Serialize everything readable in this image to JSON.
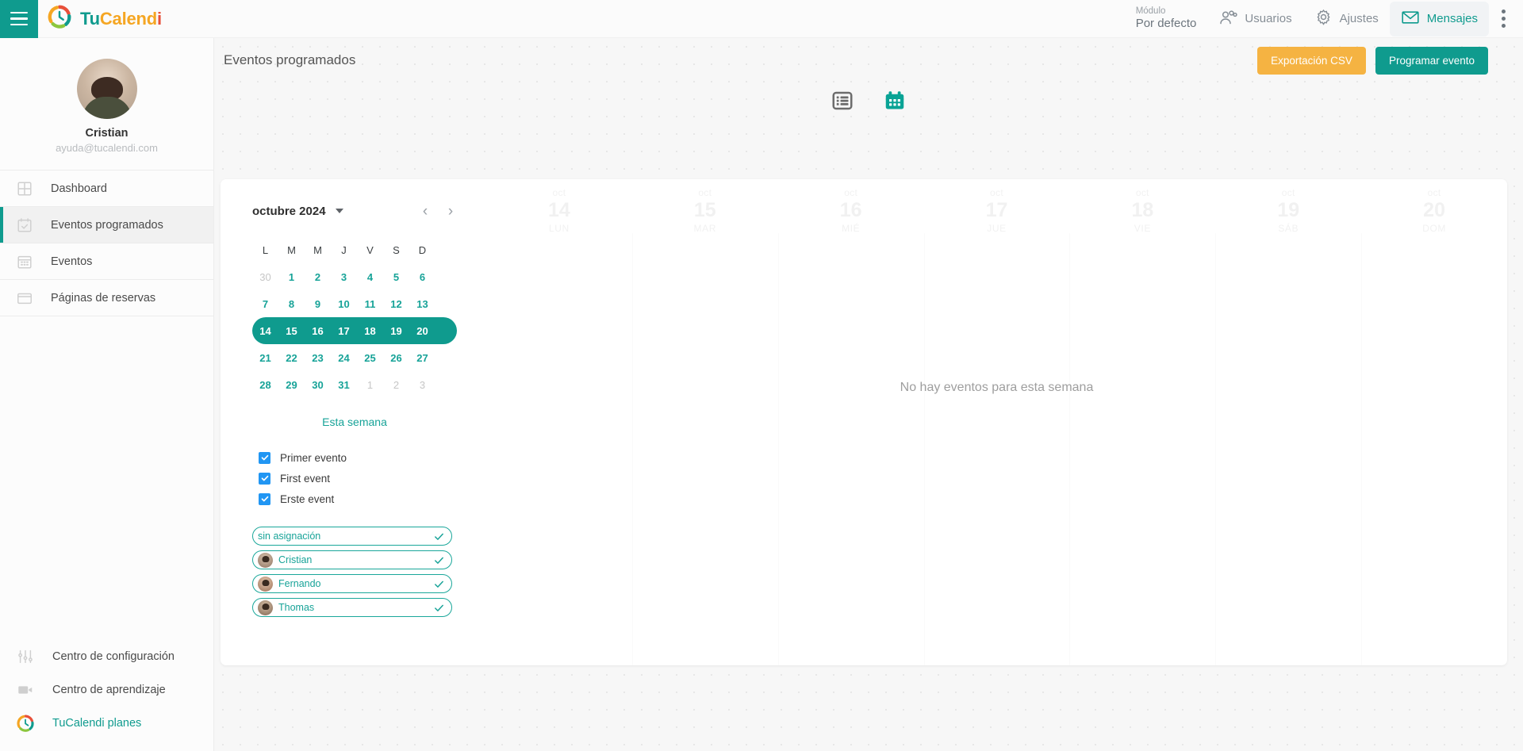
{
  "topbar": {
    "menu_icon": "hamburger-icon",
    "brand": {
      "part1": "Tu",
      "part2": "Calend",
      "part3": "i"
    },
    "module": {
      "label": "Módulo",
      "value": "Por defecto"
    },
    "nav": [
      {
        "label": "Usuarios",
        "icon": "users-icon",
        "active": false
      },
      {
        "label": "Ajustes",
        "icon": "gear-icon",
        "active": false
      },
      {
        "label": "Mensajes",
        "icon": "envelope-icon",
        "active": true
      }
    ],
    "overflow_icon": "more-vertical-icon",
    "accent": "#0f9b8e"
  },
  "sidebar": {
    "profile": {
      "name": "Cristian",
      "email": "ayuda@tucalendi.com",
      "avatar": "user-avatar"
    },
    "items": [
      {
        "label": "Dashboard",
        "icon": "dashboard-icon",
        "active": false
      },
      {
        "label": "Eventos programados",
        "icon": "calendar-check-icon",
        "active": true
      },
      {
        "label": "Eventos",
        "icon": "calendar-grid-icon",
        "active": false
      },
      {
        "label": "Páginas de reservas",
        "icon": "window-icon",
        "active": false
      }
    ],
    "bottom_items": [
      {
        "label": "Centro de configuración",
        "icon": "sliders-icon"
      },
      {
        "label": "Centro de aprendizaje",
        "icon": "video-camera-icon"
      },
      {
        "label": "TuCalendi planes",
        "icon": "tucalendi-logo-icon"
      }
    ]
  },
  "header": {
    "title": "Eventos programados",
    "export_button": "Exportación CSV",
    "schedule_button": "Programar evento",
    "export_color": "#f5b342",
    "schedule_color": "#0f9b8e"
  },
  "view_toggle": [
    {
      "name": "list-view",
      "icon": "list-icon",
      "active": false
    },
    {
      "name": "calendar-view",
      "icon": "calendar-icon",
      "active": true
    }
  ],
  "calendar": {
    "month_label": "octubre 2024",
    "caret_icon": "chevron-down-icon",
    "prev_icon": "chevron-left-icon",
    "next_icon": "chevron-right-icon",
    "dow": [
      "L",
      "M",
      "M",
      "J",
      "V",
      "S",
      "D"
    ],
    "weeks": [
      {
        "selected": false,
        "days": [
          {
            "n": "30",
            "muted": true
          },
          {
            "n": "1",
            "muted": false
          },
          {
            "n": "2",
            "muted": false
          },
          {
            "n": "3",
            "muted": false
          },
          {
            "n": "4",
            "muted": false
          },
          {
            "n": "5",
            "muted": false
          },
          {
            "n": "6",
            "muted": false
          }
        ]
      },
      {
        "selected": false,
        "days": [
          {
            "n": "7",
            "muted": false
          },
          {
            "n": "8",
            "muted": false
          },
          {
            "n": "9",
            "muted": false
          },
          {
            "n": "10",
            "muted": false
          },
          {
            "n": "11",
            "muted": false
          },
          {
            "n": "12",
            "muted": false
          },
          {
            "n": "13",
            "muted": false
          }
        ]
      },
      {
        "selected": true,
        "days": [
          {
            "n": "14",
            "muted": false
          },
          {
            "n": "15",
            "muted": false
          },
          {
            "n": "16",
            "muted": false
          },
          {
            "n": "17",
            "muted": false
          },
          {
            "n": "18",
            "muted": false
          },
          {
            "n": "19",
            "muted": false
          },
          {
            "n": "20",
            "muted": false
          }
        ]
      },
      {
        "selected": false,
        "days": [
          {
            "n": "21",
            "muted": false
          },
          {
            "n": "22",
            "muted": false
          },
          {
            "n": "23",
            "muted": false
          },
          {
            "n": "24",
            "muted": false
          },
          {
            "n": "25",
            "muted": false
          },
          {
            "n": "26",
            "muted": false
          },
          {
            "n": "27",
            "muted": false
          }
        ]
      },
      {
        "selected": false,
        "days": [
          {
            "n": "28",
            "muted": false
          },
          {
            "n": "29",
            "muted": false
          },
          {
            "n": "30",
            "muted": false
          },
          {
            "n": "31",
            "muted": false
          },
          {
            "n": "1",
            "muted": true
          },
          {
            "n": "2",
            "muted": true
          },
          {
            "n": "3",
            "muted": true
          }
        ]
      }
    ],
    "this_week_label": "Esta semana",
    "selected_color": "#0f9b8e",
    "day_color": "#17a398"
  },
  "filters": {
    "checkboxes": [
      {
        "label": "Primer evento",
        "checked": true
      },
      {
        "label": "First event",
        "checked": true
      },
      {
        "label": "Erste event",
        "checked": true
      }
    ],
    "checkbox_color": "#2196f3",
    "pills": [
      {
        "label": "sin asignación",
        "avatar": false,
        "checked": true
      },
      {
        "label": "Cristian",
        "avatar": true,
        "checked": true
      },
      {
        "label": "Fernando",
        "avatar": true,
        "checked": true
      },
      {
        "label": "Thomas",
        "avatar": true,
        "checked": true
      }
    ],
    "pill_color": "#1aa79a",
    "check_icon": "check-icon"
  },
  "week_view": {
    "days": [
      {
        "month": "oct",
        "number": "14",
        "dow": "LUN"
      },
      {
        "month": "oct",
        "number": "15",
        "dow": "MAR"
      },
      {
        "month": "oct",
        "number": "16",
        "dow": "MIÉ"
      },
      {
        "month": "oct",
        "number": "17",
        "dow": "JUE"
      },
      {
        "month": "oct",
        "number": "18",
        "dow": "VIE"
      },
      {
        "month": "oct",
        "number": "19",
        "dow": "SÁB"
      },
      {
        "month": "oct",
        "number": "20",
        "dow": "DOM"
      }
    ],
    "empty_message": "No hay eventos para esta semana"
  }
}
